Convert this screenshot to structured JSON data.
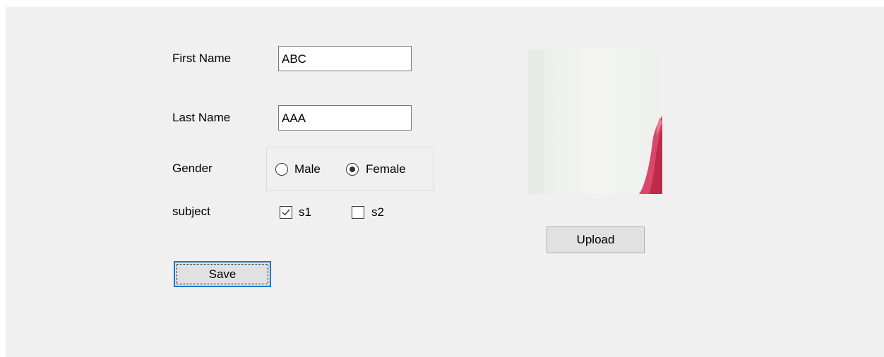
{
  "form": {
    "first_name": {
      "label": "First Name",
      "value": "ABC"
    },
    "last_name": {
      "label": "Last Name",
      "value": "AAA"
    },
    "gender": {
      "label": "Gender",
      "options": [
        {
          "label": "Male",
          "selected": false
        },
        {
          "label": "Female",
          "selected": true
        }
      ]
    },
    "subject": {
      "label": "subject",
      "options": [
        {
          "label": "s1",
          "checked": true
        },
        {
          "label": "s2",
          "checked": false
        }
      ]
    },
    "save_label": "Save",
    "upload_label": "Upload"
  },
  "colors": {
    "form_background": "#f0f0f0",
    "focus_border": "#0078d7",
    "button_face": "#e1e1e1"
  }
}
